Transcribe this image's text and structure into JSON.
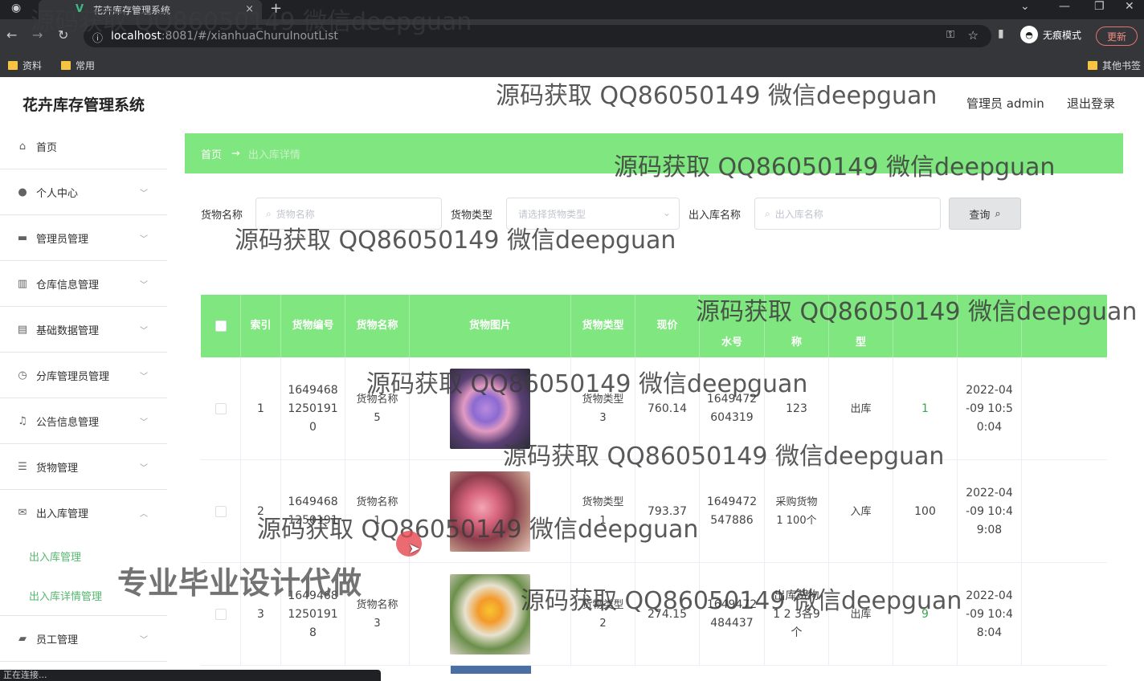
{
  "browser": {
    "tab_title": "花卉库存管理系统",
    "url_host": "localhost",
    "url_path": ":8081/#/xianhuaChuruInoutList",
    "incognito_label": "无痕模式",
    "update_label": "更新",
    "bookmarks": [
      "资料",
      "常用"
    ],
    "other_bookmarks": "其他书签",
    "status": "正在连接..."
  },
  "header": {
    "brand": "花卉库存管理系统",
    "user": "管理员 admin",
    "logout": "退出登录"
  },
  "sidebar": {
    "items": [
      {
        "label": "首页",
        "icon": "home-icon"
      },
      {
        "label": "个人中心",
        "icon": "user-icon"
      },
      {
        "label": "管理员管理",
        "icon": "monitor-icon"
      },
      {
        "label": "仓库信息管理",
        "icon": "chart-icon"
      },
      {
        "label": "基础数据管理",
        "icon": "document-icon"
      },
      {
        "label": "分库管理员管理",
        "icon": "clock-icon"
      },
      {
        "label": "公告信息管理",
        "icon": "microphone-icon"
      },
      {
        "label": "货物管理",
        "icon": "sliders-icon"
      },
      {
        "label": "出入库管理",
        "icon": "message-icon"
      }
    ],
    "sub_items": [
      "出入库管理",
      "出入库详情管理"
    ],
    "last_item": {
      "label": "员工管理",
      "icon": "chat-icon"
    }
  },
  "breadcrumb": {
    "home": "首页",
    "arrow": "→",
    "current": "出入库详情"
  },
  "search": {
    "goods_name_label": "货物名称",
    "goods_name_placeholder": "货物名称",
    "goods_type_label": "货物类型",
    "goods_type_placeholder": "请选择货物类型",
    "inout_name_label": "出入库名称",
    "inout_name_placeholder": "出入库名称",
    "query_button": "查询"
  },
  "table": {
    "headers": [
      "索引",
      "货物编号",
      "货物名称",
      "货物图片",
      "货物类型",
      "现价",
      "水号",
      "称",
      "型",
      "",
      ""
    ],
    "rows": [
      {
        "index": "1",
        "code": "1649468\n1250191\n0",
        "name": "货物名称\n5",
        "type": "货物类型\n3",
        "price": "760.14",
        "serial": "1649472\n604319",
        "inout_name": "123",
        "inout_type": "出库",
        "qty": "1",
        "time": "2022-04\n-09 10:5\n0:04"
      },
      {
        "index": "2",
        "code": "1649468\n1250191",
        "name": "货物名称\n1",
        "type": "货物类型\n1",
        "price": "793.37",
        "serial": "1649472\n547886",
        "inout_name": "采购货物\n1 100个",
        "inout_type": "入库",
        "qty": "100",
        "time": "2022-04\n-09 10:4\n9:08"
      },
      {
        "index": "3",
        "code": "1649468\n1250191\n8",
        "name": "货物名称\n3",
        "type": "货物类型\n2",
        "price": "274.15",
        "serial": "1649472\n484437",
        "inout_name": "出库货物\n1 2 3各9\n个",
        "inout_type": "出库",
        "qty": "9",
        "time": "2022-04\n-09 10:4\n8:04"
      }
    ]
  },
  "watermarks": {
    "text": "源码获取 QQ86050149 微信deepguan",
    "promo": "专业毕业设计代做"
  }
}
